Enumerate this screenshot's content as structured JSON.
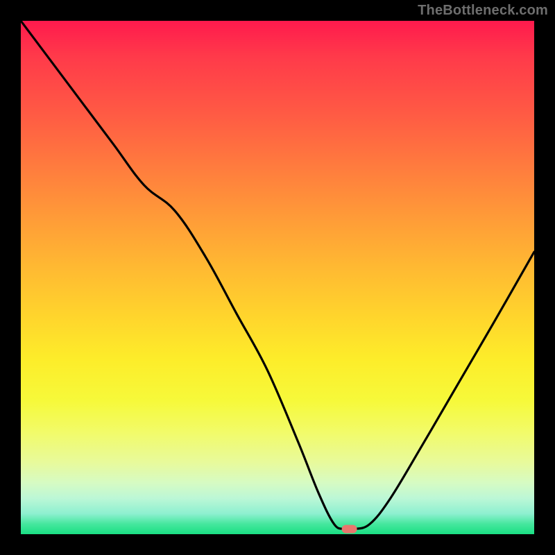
{
  "watermark": "TheBottleneck.com",
  "chart_data": {
    "type": "line",
    "title": "",
    "xlabel": "",
    "ylabel": "",
    "xlim": [
      0,
      100
    ],
    "ylim": [
      0,
      100
    ],
    "legend": false,
    "grid": false,
    "background_gradient": {
      "direction": "vertical",
      "stops": [
        {
          "pos": 0.0,
          "color": "#ff1a4d"
        },
        {
          "pos": 0.5,
          "color": "#ffd02c"
        },
        {
          "pos": 0.8,
          "color": "#f4fb70"
        },
        {
          "pos": 0.95,
          "color": "#9ef3d0"
        },
        {
          "pos": 1.0,
          "color": "#19df83"
        }
      ]
    },
    "series": [
      {
        "name": "bottleneck-curve",
        "color": "#000000",
        "x": [
          0,
          6,
          12,
          18,
          24,
          30,
          36,
          42,
          48,
          54,
          58,
          61,
          63,
          65,
          68,
          72,
          78,
          85,
          92,
          100
        ],
        "y": [
          100,
          92,
          84,
          76,
          68,
          63,
          54,
          43,
          32,
          18,
          8,
          2,
          1,
          1,
          2,
          7,
          17,
          29,
          41,
          55
        ]
      }
    ],
    "marker": {
      "name": "optimal-point",
      "shape": "rounded-rect",
      "x": 64,
      "y": 1,
      "color": "#e8766d"
    }
  }
}
